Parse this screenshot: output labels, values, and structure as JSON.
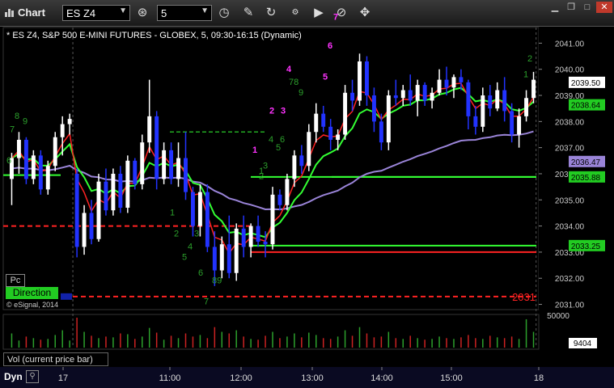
{
  "window": {
    "title": "Chart",
    "symbol": "ES Z4",
    "interval": "5"
  },
  "toolbar_icons": [
    "cursor-icon",
    "clock-icon",
    "pencil-icon",
    "hand-icon",
    "settings-icon",
    "play-icon",
    "crosshair-icon"
  ],
  "chart_info": "* ES Z4, S&P 500 E-MINI FUTURES - GLOBEX, 5, 09:30-16:15 (Dynamic)",
  "copyright": "© eSignal, 2014",
  "pc_label": "Pc",
  "direction_label": "Direction",
  "vol_label": "Vol (current price bar)",
  "dyn_label": "Dyn",
  "colors": {
    "bg": "#000000",
    "up_bar": "#ffffff",
    "down_bar": "#2233ff",
    "green": "#33ff33",
    "red": "#ff2222",
    "purple": "#9a84d8",
    "magenta": "#ff33ff"
  },
  "price_axis": {
    "ticks": [
      "2041.00",
      "2040.00",
      "2039.00",
      "2038.00",
      "2037.00",
      "2036.00",
      "2035.00",
      "2034.00",
      "2033.00",
      "2032.00",
      "2031.00"
    ],
    "tick_values": [
      2041,
      2040,
      2039,
      2038,
      2037,
      2036,
      2035,
      2034,
      2033,
      2032,
      2031
    ],
    "ymin": 2030.8,
    "ymax": 2041.6,
    "flags": [
      {
        "label": "2039.50",
        "value": 2039.5,
        "bg": "#ffffff",
        "fg": "#000000"
      },
      {
        "label": "2038.64",
        "value": 2038.64,
        "bg": "#22cc22",
        "fg": "#000000"
      },
      {
        "label": "2036.47",
        "value": 2036.47,
        "bg": "#9a84d8",
        "fg": "#000000"
      },
      {
        "label": "2035.88",
        "value": 2035.88,
        "bg": "#22cc22",
        "fg": "#000000"
      },
      {
        "label": "2033.25",
        "value": 2033.25,
        "bg": "#22cc22",
        "fg": "#000000"
      }
    ],
    "level_2031": "2031"
  },
  "volume_axis": {
    "ticks": [
      "50000"
    ],
    "current": "9404"
  },
  "time_axis": {
    "labels": [
      "17",
      "11:00",
      "12:00",
      "13:00",
      "14:00",
      "15:00",
      "18"
    ]
  },
  "chart_data": {
    "type": "candlestick",
    "title": "ES Z4, S&P 500 E-MINI FUTURES - GLOBEX, 5, 09:30-16:15 (Dynamic)",
    "candles": [
      [
        2035.8,
        2036.8,
        2034.8,
        2036.6
      ],
      [
        2036.6,
        2037.6,
        2036.0,
        2037.3
      ],
      [
        2037.3,
        2037.4,
        2035.6,
        2035.8
      ],
      [
        2035.8,
        2036.9,
        2035.6,
        2036.7
      ],
      [
        2036.7,
        2036.9,
        2035.2,
        2035.4
      ],
      [
        2035.4,
        2036.5,
        2035.2,
        2036.3
      ],
      [
        2036.3,
        2037.6,
        2036.1,
        2037.4
      ],
      [
        2037.4,
        2038.2,
        2036.7,
        2037.9
      ],
      [
        2037.9,
        2038.3,
        2037.5,
        2038.1
      ],
      [
        2036.0,
        2036.2,
        2032.8,
        2033.2
      ],
      [
        2033.2,
        2034.8,
        2032.9,
        2034.5
      ],
      [
        2034.5,
        2035.0,
        2033.3,
        2033.5
      ],
      [
        2033.5,
        2036.0,
        2033.4,
        2035.7
      ],
      [
        2035.7,
        2036.2,
        2034.4,
        2034.6
      ],
      [
        2034.6,
        2036.2,
        2034.4,
        2036.0
      ],
      [
        2036.0,
        2036.3,
        2034.5,
        2034.7
      ],
      [
        2034.7,
        2036.7,
        2034.5,
        2036.5
      ],
      [
        2036.5,
        2036.6,
        2035.4,
        2035.6
      ],
      [
        2035.6,
        2037.5,
        2035.4,
        2037.2
      ],
      [
        2037.2,
        2039.6,
        2036.8,
        2038.2
      ],
      [
        2038.2,
        2038.4,
        2035.4,
        2035.8
      ],
      [
        2035.8,
        2037.2,
        2035.6,
        2036.9
      ],
      [
        2036.9,
        2037.2,
        2035.6,
        2035.8
      ],
      [
        2035.8,
        2037.2,
        2035.5,
        2036.6
      ],
      [
        2036.6,
        2037.6,
        2035.0,
        2035.3
      ],
      [
        2035.3,
        2035.5,
        2033.6,
        2034.0
      ],
      [
        2034.0,
        2035.6,
        2033.6,
        2035.3
      ],
      [
        2035.3,
        2035.6,
        2033.0,
        2033.2
      ],
      [
        2033.2,
        2033.8,
        2031.7,
        2032.3
      ],
      [
        2032.3,
        2033.6,
        2032.0,
        2033.3
      ],
      [
        2033.3,
        2034.4,
        2032.0,
        2032.2
      ],
      [
        2032.2,
        2034.1,
        2031.9,
        2033.9
      ],
      [
        2033.9,
        2034.4,
        2032.8,
        2033.2
      ],
      [
        2033.2,
        2034.1,
        2032.8,
        2034.0
      ],
      [
        2034.0,
        2034.4,
        2033.2,
        2033.4
      ],
      [
        2033.4,
        2033.8,
        2032.8,
        2033.3
      ],
      [
        2033.3,
        2035.5,
        2033.1,
        2035.2
      ],
      [
        2035.2,
        2035.4,
        2034.6,
        2034.8
      ],
      [
        2034.8,
        2036.0,
        2034.6,
        2035.8
      ],
      [
        2035.8,
        2036.9,
        2035.5,
        2036.7
      ],
      [
        2036.7,
        2037.1,
        2036.0,
        2036.3
      ],
      [
        2036.3,
        2037.9,
        2036.1,
        2037.6
      ],
      [
        2037.6,
        2038.7,
        2037.2,
        2038.3
      ],
      [
        2038.3,
        2038.6,
        2037.6,
        2037.8
      ],
      [
        2037.8,
        2038.1,
        2036.9,
        2037.3
      ],
      [
        2037.3,
        2037.7,
        2036.9,
        2037.5
      ],
      [
        2037.5,
        2039.4,
        2037.3,
        2039.1
      ],
      [
        2039.1,
        2039.6,
        2038.4,
        2038.8
      ],
      [
        2038.8,
        2040.6,
        2038.6,
        2040.3
      ],
      [
        2040.3,
        2040.5,
        2038.6,
        2039.0
      ],
      [
        2039.0,
        2039.3,
        2037.6,
        2038.0
      ],
      [
        2038.0,
        2038.3,
        2036.9,
        2037.2
      ],
      [
        2037.2,
        2039.2,
        2036.9,
        2039.0
      ],
      [
        2039.0,
        2039.6,
        2038.6,
        2038.9
      ],
      [
        2038.9,
        2039.4,
        2038.6,
        2039.2
      ],
      [
        2039.2,
        2039.8,
        2038.6,
        2038.8
      ],
      [
        2038.8,
        2039.6,
        2038.2,
        2039.4
      ],
      [
        2039.4,
        2039.5,
        2038.6,
        2038.8
      ],
      [
        2038.8,
        2039.3,
        2038.5,
        2039.1
      ],
      [
        2039.1,
        2040.0,
        2039.0,
        2039.6
      ],
      [
        2039.6,
        2040.1,
        2039.0,
        2039.3
      ],
      [
        2039.3,
        2039.8,
        2038.9,
        2039.7
      ],
      [
        2039.7,
        2040.0,
        2039.2,
        2039.5
      ],
      [
        2039.5,
        2039.6,
        2037.7,
        2038.2
      ],
      [
        2038.2,
        2038.6,
        2037.5,
        2037.8
      ],
      [
        2037.8,
        2039.3,
        2037.6,
        2039.0
      ],
      [
        2039.0,
        2039.4,
        2038.2,
        2038.5
      ],
      [
        2038.5,
        2039.5,
        2038.4,
        2039.2
      ],
      [
        2039.2,
        2039.7,
        2038.0,
        2038.4
      ],
      [
        2038.4,
        2038.7,
        2037.2,
        2037.5
      ],
      [
        2037.5,
        2038.5,
        2037.0,
        2038.2
      ],
      [
        2038.2,
        2039.2,
        2038.0,
        2038.9
      ],
      [
        2038.9,
        2039.9,
        2038.7,
        2039.6
      ]
    ],
    "green_levels": [
      2033.25,
      2035.88
    ],
    "red_levels": [
      2033.0
    ],
    "red_dashed_levels": [
      2034.0,
      2031.3
    ],
    "green_dashed_level": 2037.6,
    "count_labels": [
      {
        "text": "8",
        "color": "green"
      },
      {
        "text": "9",
        "color": "green"
      },
      {
        "text": "7",
        "color": "green"
      },
      {
        "text": "6",
        "color": "green"
      },
      {
        "text": "1",
        "color": "green"
      },
      {
        "text": "2",
        "color": "green"
      },
      {
        "text": "3",
        "color": "green"
      },
      {
        "text": "4",
        "color": "green"
      },
      {
        "text": "5",
        "color": "green"
      },
      {
        "text": "6",
        "color": "green"
      },
      {
        "text": "89",
        "color": "green"
      },
      {
        "text": "7",
        "color": "green"
      },
      {
        "text": "1",
        "color": "magenta"
      },
      {
        "text": "2",
        "color": "magenta"
      },
      {
        "text": "3",
        "color": "magenta"
      },
      {
        "text": "4",
        "color": "magenta"
      },
      {
        "text": "5",
        "color": "magenta"
      },
      {
        "text": "6",
        "color": "magenta"
      },
      {
        "text": "7",
        "color": "magenta"
      },
      {
        "text": "78",
        "color": "green"
      },
      {
        "text": "9",
        "color": "green"
      },
      {
        "text": "2",
        "color": "green"
      },
      {
        "text": "1",
        "color": "green"
      }
    ],
    "volume_values": [
      18,
      9,
      14,
      12,
      10,
      11,
      16,
      22,
      9,
      38,
      20,
      15,
      12,
      14,
      13,
      18,
      17,
      11,
      14,
      25,
      19,
      10,
      15,
      12,
      18,
      14,
      16,
      12,
      26,
      20,
      18,
      22,
      14,
      11,
      10,
      15,
      20,
      12,
      14,
      18,
      13,
      19,
      16,
      12,
      11,
      14,
      22,
      15,
      26,
      18,
      13,
      14,
      20,
      12,
      11,
      15,
      12,
      10,
      11,
      14,
      12,
      11,
      13,
      16,
      12,
      11,
      15,
      13,
      12,
      14,
      11,
      36,
      20
    ]
  }
}
